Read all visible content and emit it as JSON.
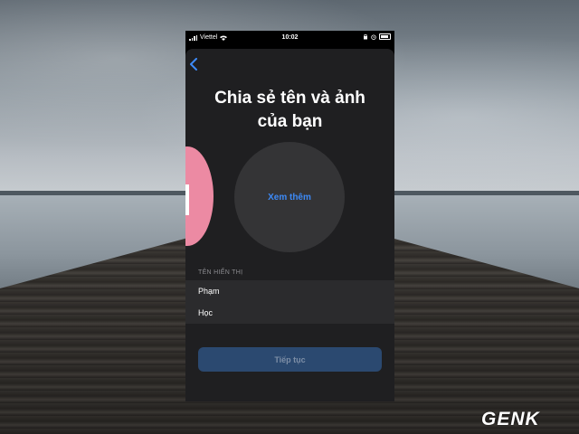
{
  "status_bar": {
    "carrier": "Viettel",
    "time": "10:02"
  },
  "screen": {
    "title_line1": "Chia sẻ tên và ảnh",
    "title_line2": "của bạn",
    "see_more_label": "Xem thêm",
    "display_name_label": "TÊN HIỂN THỊ",
    "first_name_value": "Phạm",
    "last_name_value": "Học",
    "continue_label": "Tiếp tục"
  },
  "watermark": {
    "text": "GENK"
  },
  "colors": {
    "accent": "#3d8af7",
    "sheet": "#1f1f21",
    "button": "#2b4970",
    "avatar_pink": "#ec8aa3"
  }
}
